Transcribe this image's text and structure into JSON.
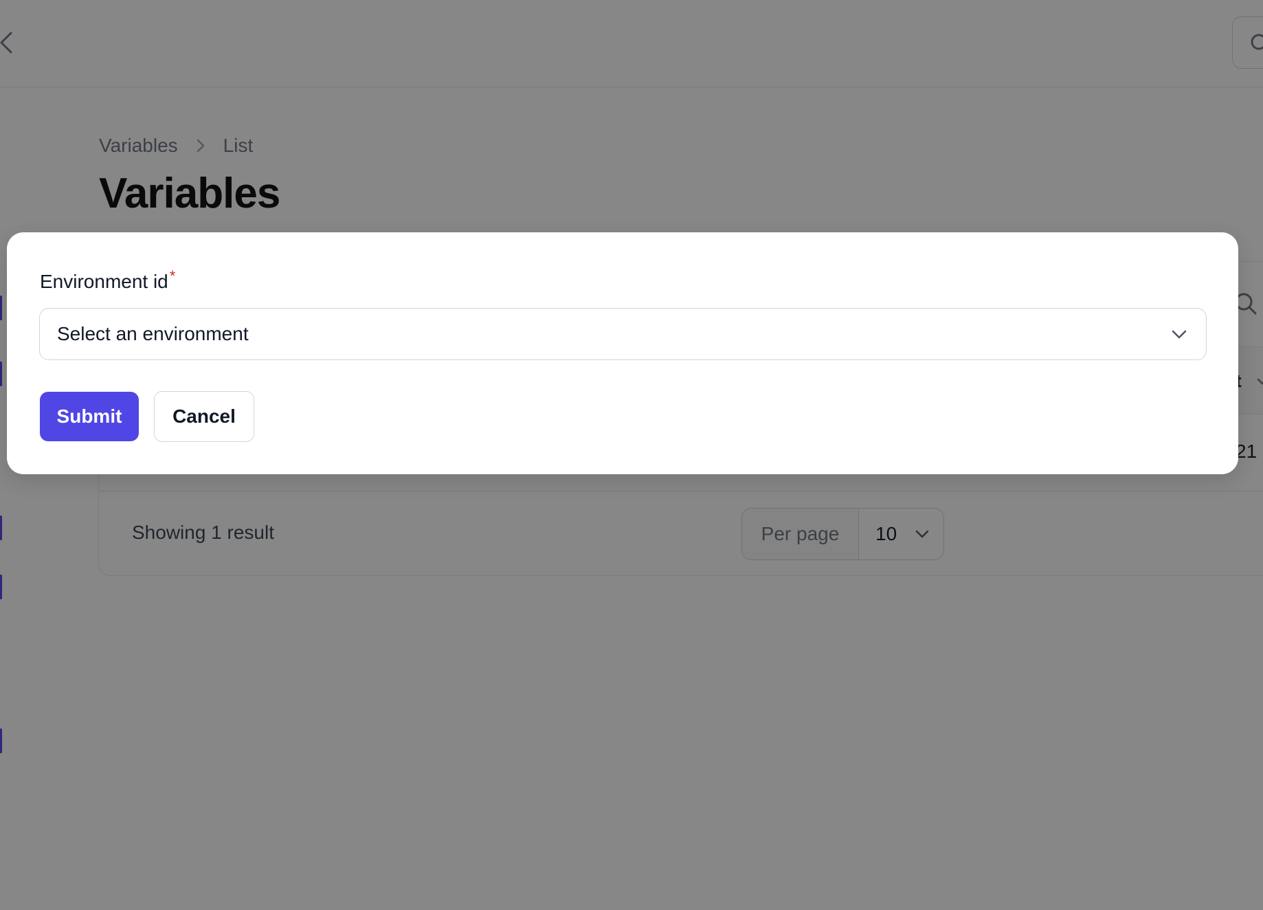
{
  "breadcrumb": {
    "items": [
      "Variables",
      "List"
    ]
  },
  "page": {
    "title": "Variables"
  },
  "table": {
    "column_header_partial": "t",
    "row_value_partial": "21",
    "footer": {
      "showing": "Showing 1 result",
      "per_page_label": "Per page",
      "per_page_value": "10"
    }
  },
  "modal": {
    "field_label": "Environment id",
    "required_marker": "*",
    "select_placeholder": "Select an environment",
    "submit_label": "Submit",
    "cancel_label": "Cancel"
  },
  "colors": {
    "accent": "#4f46e5",
    "required": "#dc2626",
    "overlay": "rgba(10,10,10,0.49)"
  },
  "icons": {
    "back": "chevron-left-icon",
    "search": "search-icon",
    "select": "chevron-down-icon"
  }
}
